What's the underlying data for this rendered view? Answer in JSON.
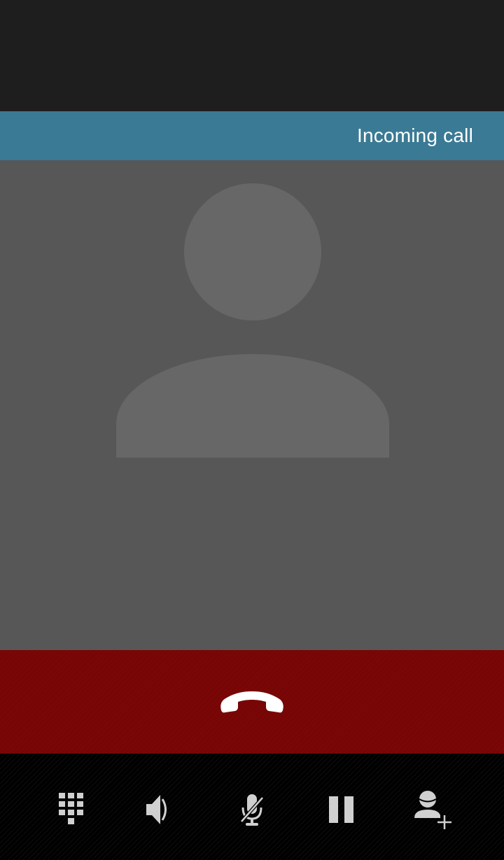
{
  "header": {
    "status_text": "Incoming call",
    "bar_color": "#3a7a94"
  },
  "caller": {
    "avatar_icon": "default-contact-silhouette-icon"
  },
  "end_call": {
    "icon": "end-call-icon",
    "color": "#7a0606"
  },
  "controls": [
    {
      "id": "dialpad",
      "icon": "dialpad-icon"
    },
    {
      "id": "speaker",
      "icon": "speaker-icon"
    },
    {
      "id": "mute",
      "icon": "mute-microphone-icon"
    },
    {
      "id": "hold",
      "icon": "pause-icon"
    },
    {
      "id": "add-call",
      "icon": "add-contact-icon"
    }
  ]
}
